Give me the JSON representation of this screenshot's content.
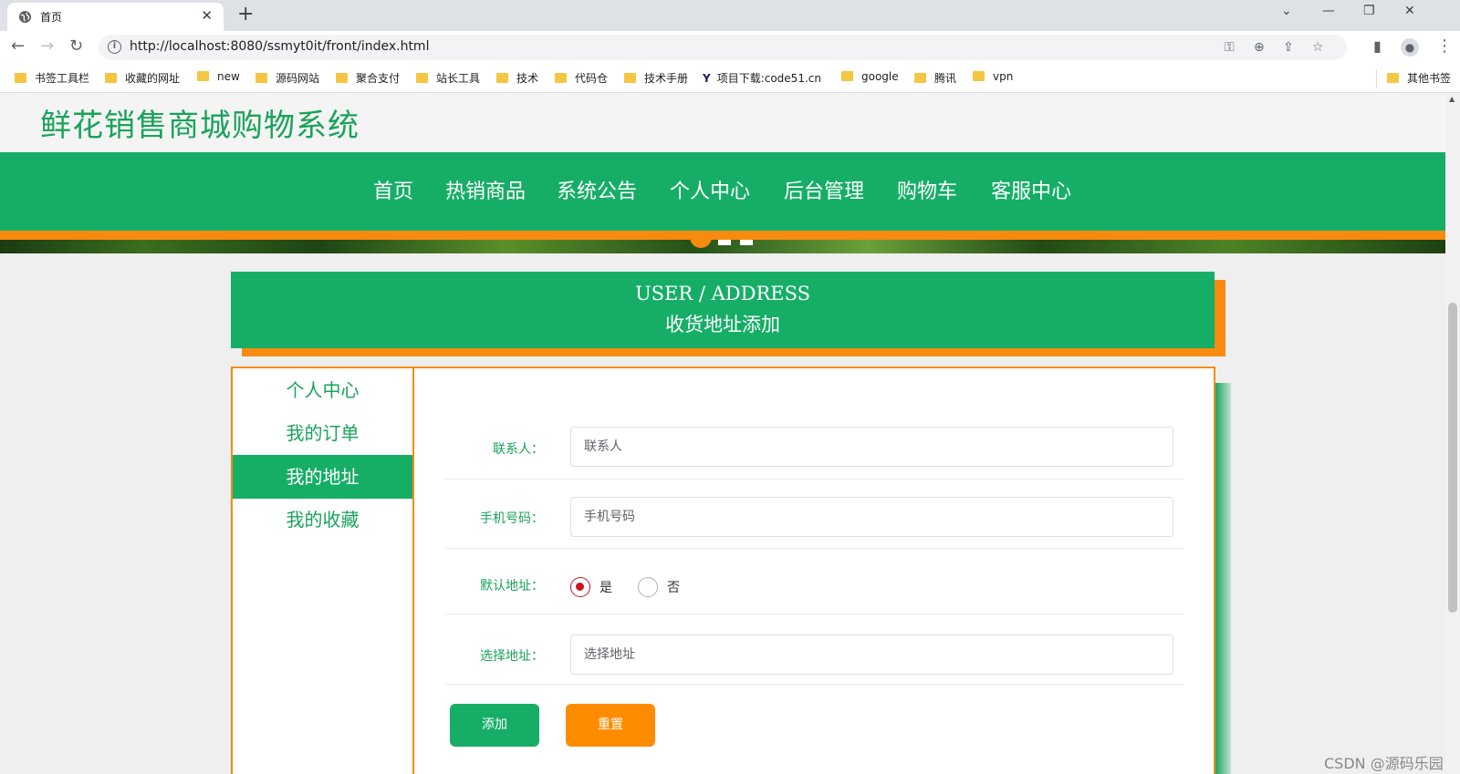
{
  "browser": {
    "tab_title": "首页",
    "tab_close": "✕",
    "new_tab": "+",
    "url": "http://localhost:8080/ssmyt0it/front/index.html",
    "window_controls": [
      "⌄",
      "—",
      "❐",
      "✕"
    ],
    "bookmarks": [
      {
        "label": "书签工具栏",
        "icon": "folder-icon"
      },
      {
        "label": "收藏的网址",
        "icon": "folder-icon"
      },
      {
        "label": "new",
        "icon": "folder-icon"
      },
      {
        "label": "源码网站",
        "icon": "folder-icon"
      },
      {
        "label": "聚合支付",
        "icon": "folder-icon"
      },
      {
        "label": "站长工具",
        "icon": "folder-icon"
      },
      {
        "label": "技术",
        "icon": "folder-icon"
      },
      {
        "label": "代码仓",
        "icon": "folder-icon"
      },
      {
        "label": "技术手册",
        "icon": "folder-icon"
      },
      {
        "label": "项目下载:code51.cn",
        "icon": "site-logo-icon"
      },
      {
        "label": "google",
        "icon": "folder-icon"
      },
      {
        "label": "腾讯",
        "icon": "folder-icon"
      },
      {
        "label": "vpn",
        "icon": "folder-icon"
      }
    ],
    "other_bookmarks": "其他书签"
  },
  "site": {
    "title": "鲜花销售商城购物系统",
    "nav": [
      "首页",
      "热销商品",
      "系统公告",
      "个人中心",
      "后台管理",
      "购物车",
      "客服中心"
    ]
  },
  "section": {
    "title_en": "USER / ADDRESS",
    "title_cn": "收货地址添加"
  },
  "sidebar": {
    "items": [
      "个人中心",
      "我的订单",
      "我的地址",
      "我的收藏"
    ],
    "active": "我的地址"
  },
  "form": {
    "contact": {
      "label": "联系人：",
      "placeholder": "联系人",
      "value": ""
    },
    "phone": {
      "label": "手机号码：",
      "placeholder": "手机号码",
      "value": ""
    },
    "default_address": {
      "label": "默认地址：",
      "options": [
        "是",
        "否"
      ],
      "selected": "是"
    },
    "address": {
      "label": "选择地址：",
      "placeholder": "选择地址",
      "value": ""
    },
    "add_button": "添加",
    "reset_button": "重置"
  },
  "colors": {
    "brand_green": "#16ae67",
    "accent_orange": "#f68b10",
    "radio_red": "#c8161d"
  },
  "watermark": "CSDN @源码乐园"
}
